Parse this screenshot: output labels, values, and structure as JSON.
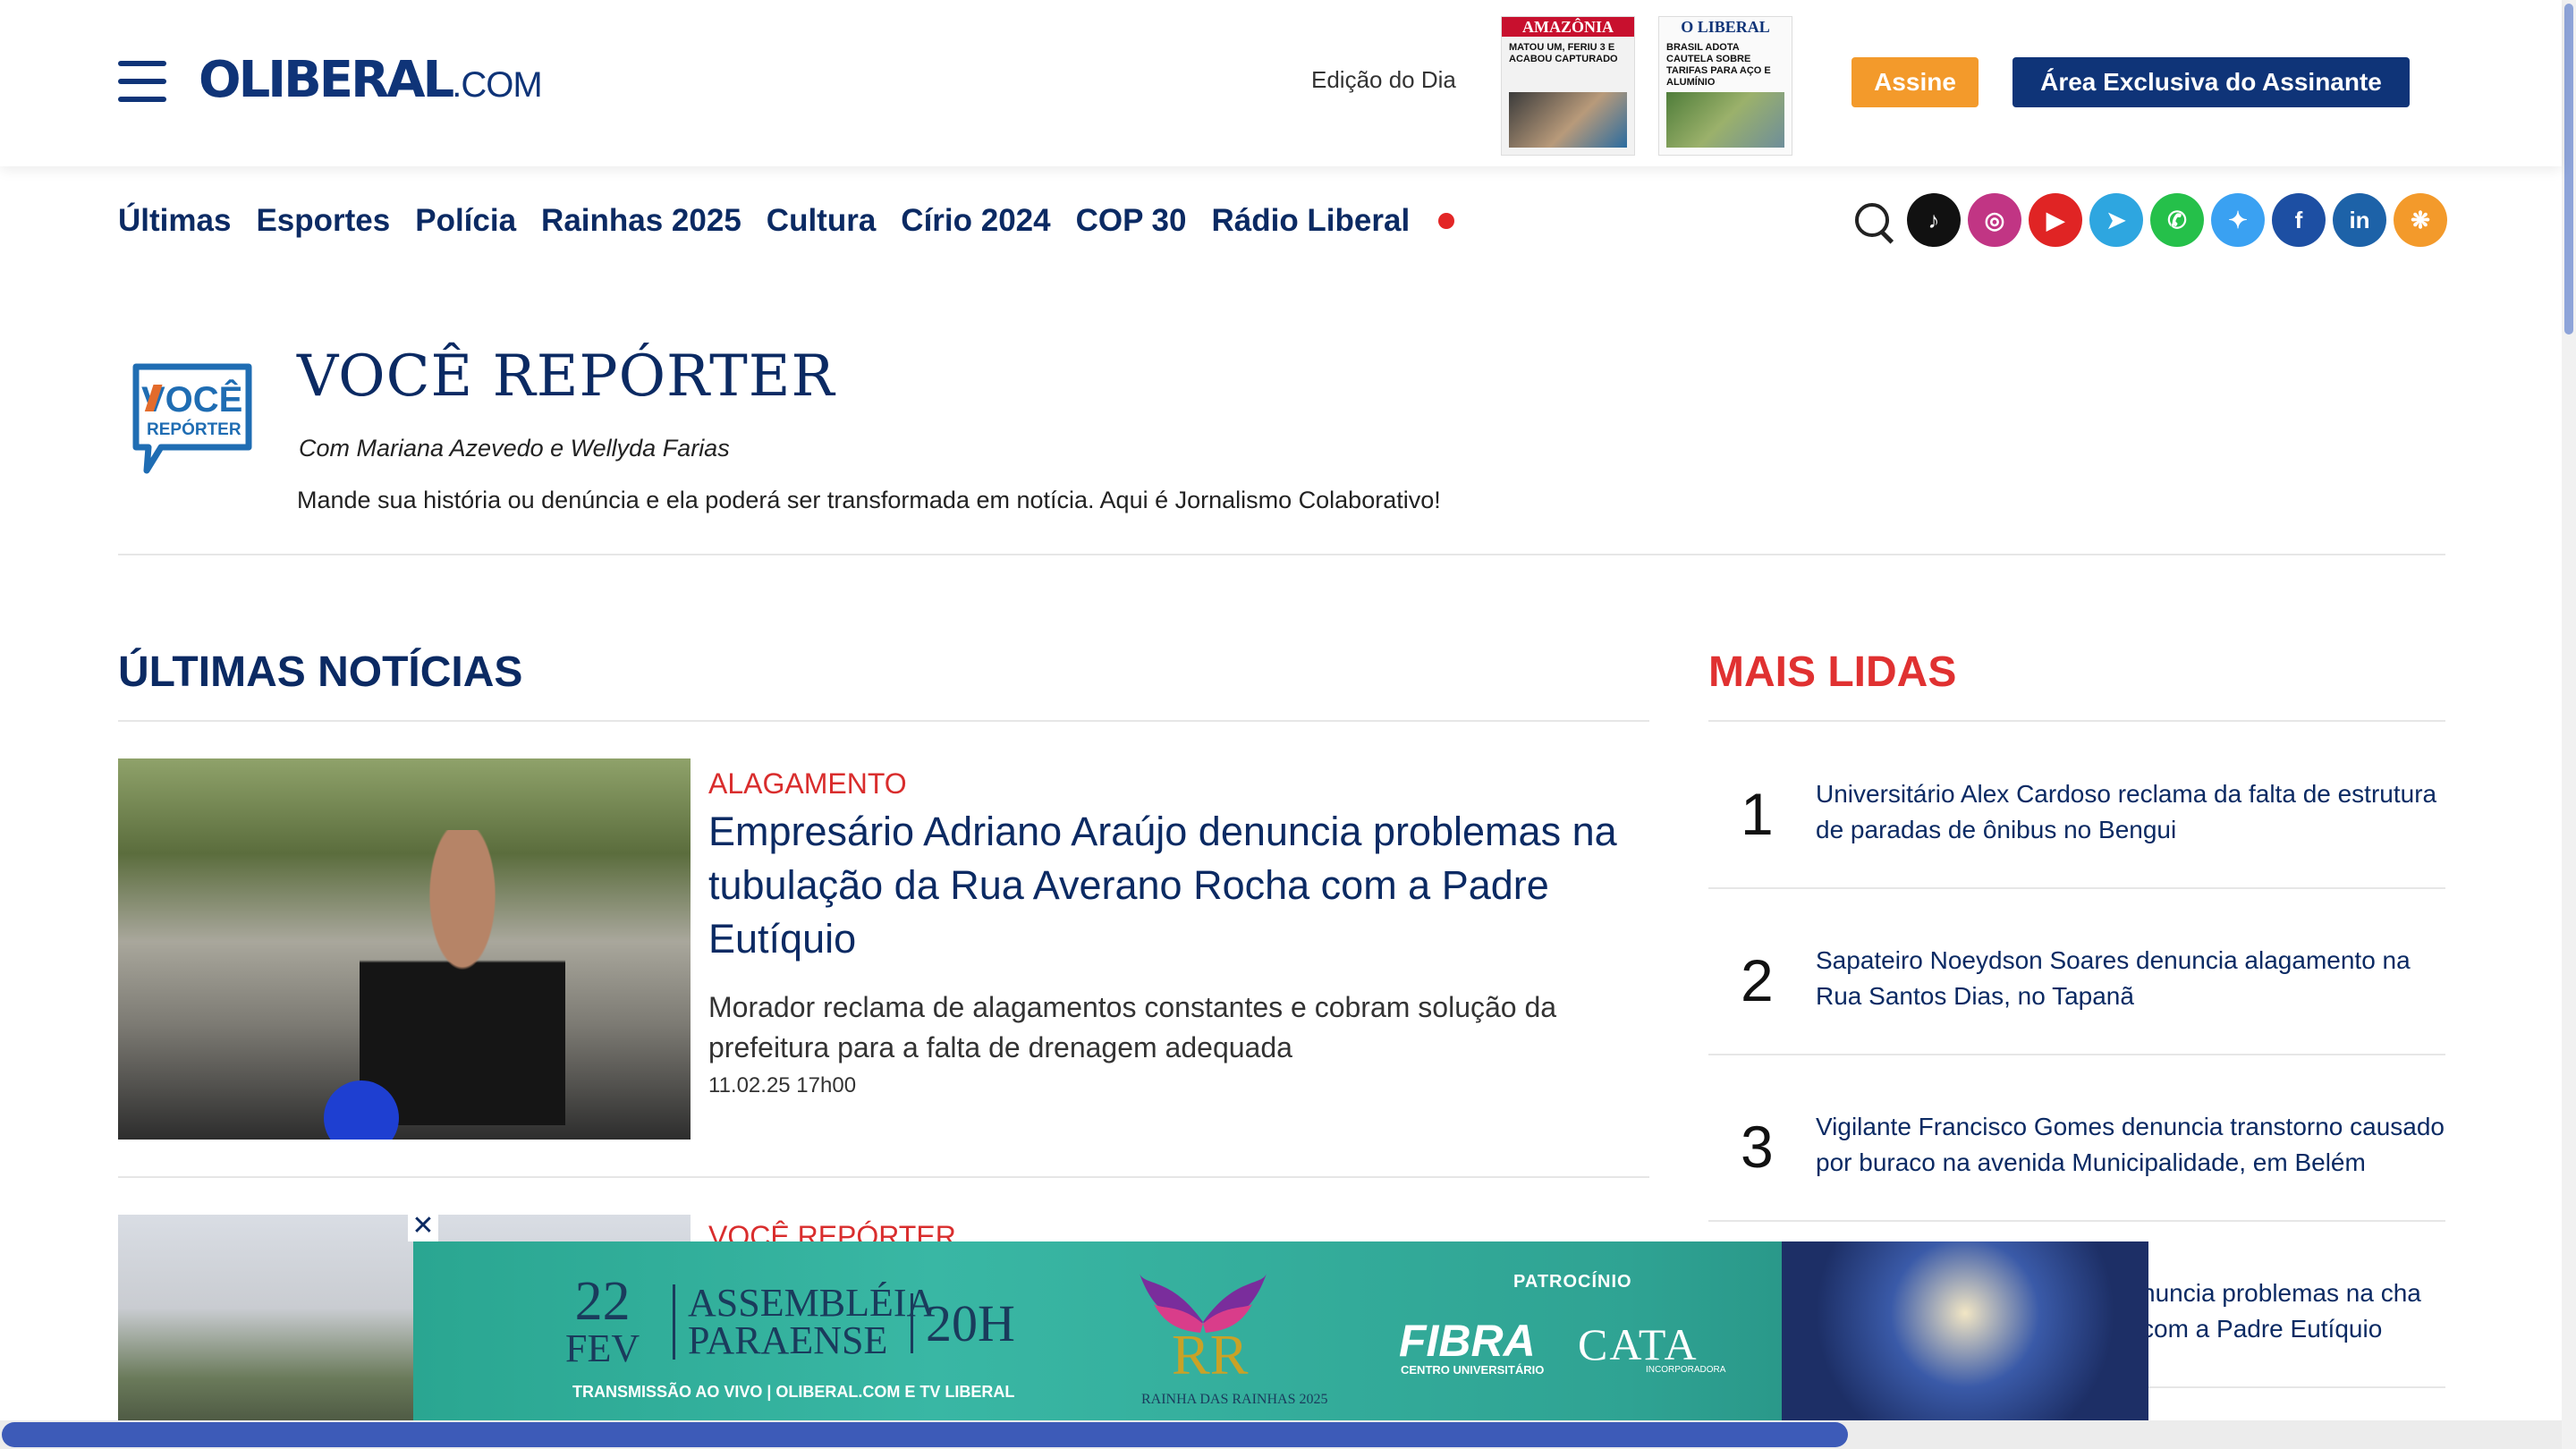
{
  "header": {
    "logo_brand": "OLIBERAL",
    "logo_tld": ".COM",
    "edicao_label": "Edição do Dia",
    "papers": [
      {
        "masthead": "AMAZÔNIA",
        "headline": "MATOU UM, FERIU 3 E ACABOU CAPTURADO"
      },
      {
        "masthead": "O LIBERAL",
        "headline": "BRASIL ADOTA CAUTELA SOBRE TARIFAS PARA AÇO E ALUMÍNIO"
      }
    ],
    "assine_label": "Assine",
    "area_label": "Área Exclusiva do Assinante"
  },
  "nav": {
    "items": [
      "Últimas",
      "Esportes",
      "Polícia",
      "Rainhas 2025",
      "Cultura",
      "Círio 2024",
      "COP 30",
      "Rádio Liberal"
    ]
  },
  "social": [
    {
      "name": "tiktok",
      "color": "#111111",
      "glyph": "♪"
    },
    {
      "name": "instagram",
      "color": "#c13584",
      "glyph": "◎"
    },
    {
      "name": "youtube",
      "color": "#e02424",
      "glyph": "▶"
    },
    {
      "name": "telegram",
      "color": "#2ea6e0",
      "glyph": "➤"
    },
    {
      "name": "whatsapp",
      "color": "#25c04a",
      "glyph": "✆"
    },
    {
      "name": "twitter",
      "color": "#3aa1f2",
      "glyph": "✦"
    },
    {
      "name": "facebook",
      "color": "#1d4fa3",
      "glyph": "f"
    },
    {
      "name": "linkedin",
      "color": "#1d62a8",
      "glyph": "in"
    },
    {
      "name": "google-news",
      "color": "#f39a2b",
      "glyph": "❋"
    }
  ],
  "section": {
    "logo_word1": "VOCÊ",
    "logo_word2": "REPÓRTER",
    "title": "VOCÊ REPÓRTER",
    "subtitle": "Com Mariana Azevedo e Wellyda Farias",
    "description": "Mande sua história ou denúncia e ela poderá ser transformada em notícia. Aqui é Jornalismo Colaborativo!"
  },
  "latest": {
    "title": "ÚLTIMAS NOTÍCIAS",
    "items": [
      {
        "category": "ALAGAMENTO",
        "headline": "Empresário Adriano Araújo denuncia problemas na tubulação da Rua Averano Rocha com a Padre Eutíquio",
        "summary": "Morador reclama de alagamentos constantes e cobram solução da prefeitura para a falta de drenagem adequada",
        "date": "11.02.25 17h00"
      },
      {
        "category": "VOCÊ REPÓRTER"
      }
    ]
  },
  "most_read": {
    "title": "MAIS LIDAS",
    "items": [
      {
        "rank": "1",
        "title": "Universitário Alex Cardoso reclama da falta de estrutura de paradas de ônibus no Bengui"
      },
      {
        "rank": "2",
        "title": "Sapateiro Noeydson Soares denuncia alagamento na Rua Santos Dias, no Tapanã"
      },
      {
        "rank": "3",
        "title": "Vigilante Francisco Gomes denuncia transtorno causado por buraco na avenida Municipalidade, em Belém"
      },
      {
        "rank": "4",
        "title": "nuncia problemas na cha com a Padre Eutíquio"
      }
    ]
  },
  "ad": {
    "close": "✕",
    "day": "22",
    "month": "FEV",
    "place": "ASSEMBLÉIA PARAENSE",
    "hour": "20H",
    "broadcast": "TRANSMISSÃO AO VIVO | OLIBERAL.COM E TV LIBERAL",
    "event": "RAINHA DAS RAINHAS 2025",
    "sponsor_label": "PATROCÍNIO",
    "sponsor1": "FIBRA",
    "sponsor1_sub": "CENTRO UNIVERSITÁRIO",
    "sponsor2": "CATA",
    "sponsor2_sub": "INCORPORADORA"
  }
}
